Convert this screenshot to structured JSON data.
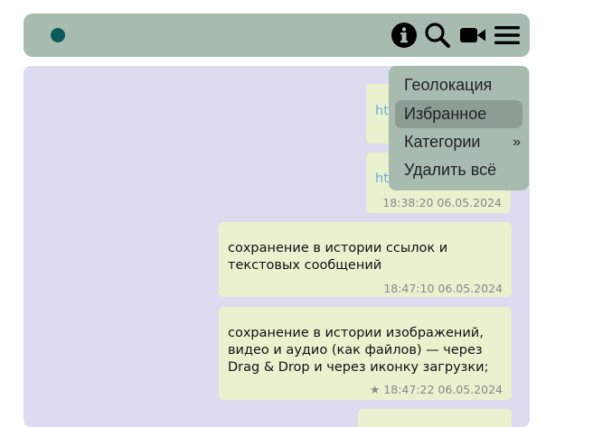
{
  "header": {
    "status_color": "#0d5c5d",
    "icons": [
      "info-icon",
      "search-icon",
      "video-camera-icon",
      "hamburger-menu-icon"
    ]
  },
  "messages": [
    {
      "link": "ht",
      "time": ""
    },
    {
      "link": "ht",
      "time": "18:38:20 06.05.2024"
    },
    {
      "text": "сохранение в истории ссылок и текстовых сообщений",
      "time": "18:47:10 06.05.2024"
    },
    {
      "text": "сохранение в истории изображений, видео и аудио (как файлов) — через Drag & Drop и через иконку загрузки;",
      "time": "★ 18:47:22 06.05.2024"
    }
  ],
  "menu": {
    "items": [
      {
        "label": "Геолокация"
      },
      {
        "label": "Избранное",
        "active": true
      },
      {
        "label": "Категории",
        "arrow": "»"
      },
      {
        "label": "Удалить всё"
      }
    ]
  }
}
